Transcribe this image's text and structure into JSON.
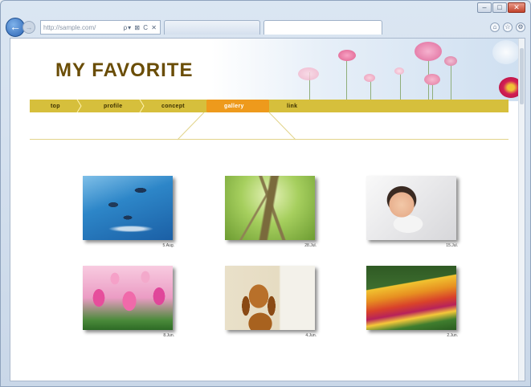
{
  "browser": {
    "address": "http://sample.com/",
    "address_icons": "ρ▾ ⊠ C ✕",
    "tabs": [
      "",
      ""
    ],
    "window_controls": [
      "–",
      "□",
      "✕"
    ],
    "toolbar_icons": [
      "home-icon",
      "star-icon",
      "gear-icon"
    ],
    "toolbar_icon_glyphs": [
      "⌂",
      "☆",
      "⚙"
    ]
  },
  "site": {
    "title": "MY FAVORITE"
  },
  "nav": {
    "items": [
      "top",
      "profile",
      "concept",
      "gallery",
      "link"
    ],
    "active": "gallery"
  },
  "gallery": {
    "photos": [
      {
        "subject": "dolphins",
        "caption": "5.Aug."
      },
      {
        "subject": "tree",
        "caption": "28.Jul."
      },
      {
        "subject": "baby",
        "caption": "15.Jul."
      },
      {
        "subject": "tulips",
        "caption": "8.Jun."
      },
      {
        "subject": "dog",
        "caption": "4.Jun."
      },
      {
        "subject": "flower-bed",
        "caption": "2.Jun."
      }
    ]
  },
  "colors": {
    "title": "#6a4d06",
    "nav_bar": "#d6bf3c",
    "nav_active": "#ee9a1c"
  }
}
